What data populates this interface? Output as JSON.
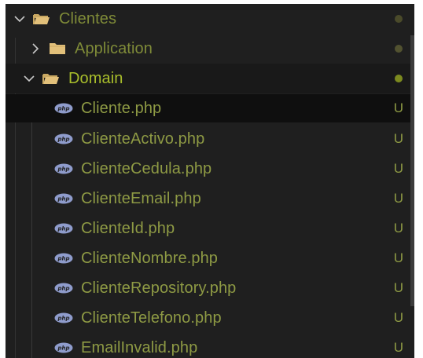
{
  "explorer": {
    "root": {
      "label": "Clientes",
      "icon": "folder-open-icon",
      "chevron": "chevron-down-icon",
      "status_color": "#4a4a2a"
    },
    "folders": [
      {
        "label": "Application",
        "icon": "folder-closed-icon",
        "chevron": "chevron-right-icon",
        "status_color": "#525230"
      },
      {
        "label": "Domain",
        "icon": "folder-open-icon",
        "chevron": "chevron-down-icon",
        "status_color": "#7c8a1f"
      }
    ],
    "files": [
      {
        "name": "Cliente.php",
        "icon": "php-icon",
        "status": "U"
      },
      {
        "name": "ClienteActivo.php",
        "icon": "php-icon",
        "status": "U"
      },
      {
        "name": "ClienteCedula.php",
        "icon": "php-icon",
        "status": "U"
      },
      {
        "name": "ClienteEmail.php",
        "icon": "php-icon",
        "status": "U"
      },
      {
        "name": "ClienteId.php",
        "icon": "php-icon",
        "status": "U"
      },
      {
        "name": "ClienteNombre.php",
        "icon": "php-icon",
        "status": "U"
      },
      {
        "name": "ClienteRepository.php",
        "icon": "php-icon",
        "status": "U"
      },
      {
        "name": "ClienteTelefono.php",
        "icon": "php-icon",
        "status": "U"
      },
      {
        "name": "EmailInvalid.php",
        "icon": "php-icon",
        "status": "U"
      }
    ]
  },
  "colors": {
    "panel_bg": "#1f1f1f",
    "file_text": "#8e9a44",
    "domain_text": "#a9be2b",
    "folder_icon": "#e2c07a",
    "php_icon": "#8f9ccc"
  }
}
